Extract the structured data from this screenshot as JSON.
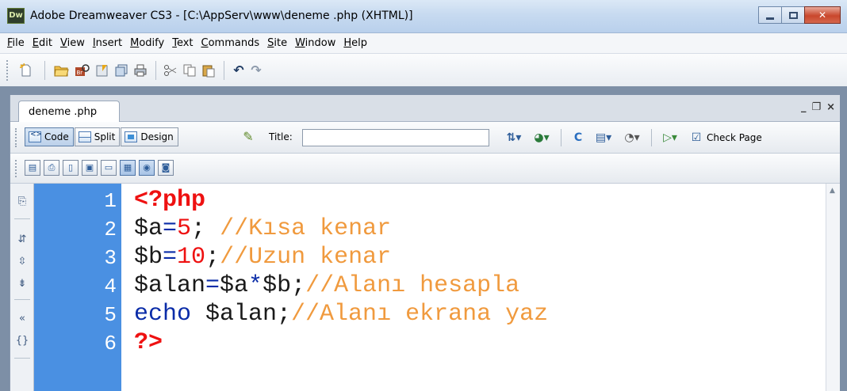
{
  "window": {
    "app_logo": "Dw",
    "title": "Adobe Dreamweaver CS3 - [C:\\AppServ\\www\\deneme .php (XHTML)]",
    "controls": [
      "minimize-icon",
      "maximize-icon",
      "close-icon"
    ]
  },
  "menu": [
    {
      "label": "File",
      "acc": "F",
      "rest": "ile"
    },
    {
      "label": "Edit",
      "acc": "E",
      "rest": "dit"
    },
    {
      "label": "View",
      "acc": "V",
      "rest": "iew"
    },
    {
      "label": "Insert",
      "acc": "I",
      "rest": "nsert"
    },
    {
      "label": "Modify",
      "acc": "M",
      "rest": "odify"
    },
    {
      "label": "Text",
      "acc": "T",
      "rest": "ext"
    },
    {
      "label": "Commands",
      "acc": "C",
      "rest": "ommands"
    },
    {
      "label": "Site",
      "acc": "S",
      "rest": "ite"
    },
    {
      "label": "Window",
      "acc": "W",
      "rest": "indow"
    },
    {
      "label": "Help",
      "acc": "H",
      "rest": "elp"
    }
  ],
  "toolbar_icons": [
    "new-file-icon",
    "open-file-icon",
    "browse-in-bridge-icon",
    "save-icon",
    "save-all-icon",
    "print-icon",
    "cut-icon",
    "copy-icon",
    "paste-icon",
    "undo-icon",
    "redo-icon"
  ],
  "document": {
    "tab_label": "deneme .php",
    "panel_controls": {
      "minimize": "_",
      "restore": "❐",
      "close": "×"
    },
    "views": {
      "code": "Code",
      "split": "Split",
      "design": "Design"
    },
    "active_view": "Code",
    "title_label": "Title:",
    "title_value": "",
    "check_page": "Check Page"
  },
  "code": {
    "lines": [
      {
        "n": "1",
        "tokens": [
          {
            "t": "<?php",
            "c": "tag"
          }
        ]
      },
      {
        "n": "2",
        "tokens": [
          {
            "t": "$a",
            "c": "var"
          },
          {
            "t": "=",
            "c": "op"
          },
          {
            "t": "5",
            "c": "num"
          },
          {
            "t": "; ",
            "c": "var"
          },
          {
            "t": "//Kısa kenar",
            "c": "com"
          }
        ]
      },
      {
        "n": "3",
        "tokens": [
          {
            "t": "$b",
            "c": "var"
          },
          {
            "t": "=",
            "c": "op"
          },
          {
            "t": "10",
            "c": "num"
          },
          {
            "t": ";",
            "c": "var"
          },
          {
            "t": "//Uzun kenar",
            "c": "com"
          }
        ]
      },
      {
        "n": "4",
        "tokens": [
          {
            "t": "$alan",
            "c": "var"
          },
          {
            "t": "=",
            "c": "op"
          },
          {
            "t": "$a",
            "c": "var"
          },
          {
            "t": "*",
            "c": "op"
          },
          {
            "t": "$b;",
            "c": "var"
          },
          {
            "t": "//Alanı hesapla",
            "c": "com"
          }
        ]
      },
      {
        "n": "5",
        "tokens": [
          {
            "t": "echo ",
            "c": "kw"
          },
          {
            "t": "$alan;",
            "c": "var"
          },
          {
            "t": "//Alanı ekrana yaz",
            "c": "com"
          }
        ]
      },
      {
        "n": "6",
        "tokens": [
          {
            "t": "?>",
            "c": "tag"
          }
        ]
      }
    ]
  },
  "colors": {
    "gutter": "#4a90e2",
    "php_tag": "#ee1111",
    "number": "#ee1111",
    "operator": "#0a2ca8",
    "comment": "#f09a3e"
  }
}
